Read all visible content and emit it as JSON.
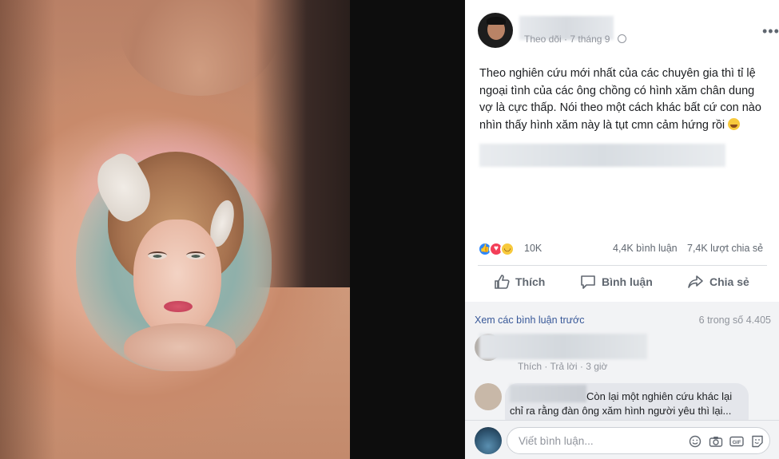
{
  "post": {
    "meta_follow": "Theo dõi",
    "meta_date": "· 7 tháng 9",
    "more": "•••",
    "text": "Theo nghiên cứu mới nhất của các chuyên gia thì tỉ lệ ngoại tình của các ông chồng có hình xăm chân dung vợ là cực thấp. Nói theo một cách khác bất cứ con nào nhìn thấy hình xăm này là tụt cmn cảm hứng rồi"
  },
  "stats": {
    "reactions": "10K",
    "comments": "4,4K bình luận",
    "shares": "7,4K lượt chia sẻ"
  },
  "actions": {
    "like": "Thích",
    "comment": "Bình luận",
    "share": "Chia sẻ"
  },
  "comments": {
    "view_previous": "Xem các bình luận trước",
    "count_of": "6 trong số 4.405",
    "c1_meta": "Thích · Trả lời · 3 giờ",
    "c2_text": "Còn lại một nghiên cứu khác lại chỉ ra rằng đàn ông xăm hình người yêu thì lại..."
  },
  "composer": {
    "placeholder": "Viết bình luận..."
  },
  "colors": {
    "link": "#385898",
    "secondary": "#90949c",
    "like": "#2d88ff",
    "love": "#f33e58",
    "haha": "#f7c93c"
  },
  "icons": [
    "like-icon",
    "love-icon",
    "haha-icon",
    "thumb-up-icon",
    "comment-icon",
    "share-icon",
    "emoji-icon",
    "camera-icon",
    "gif-icon",
    "sticker-icon",
    "globe-icon"
  ]
}
